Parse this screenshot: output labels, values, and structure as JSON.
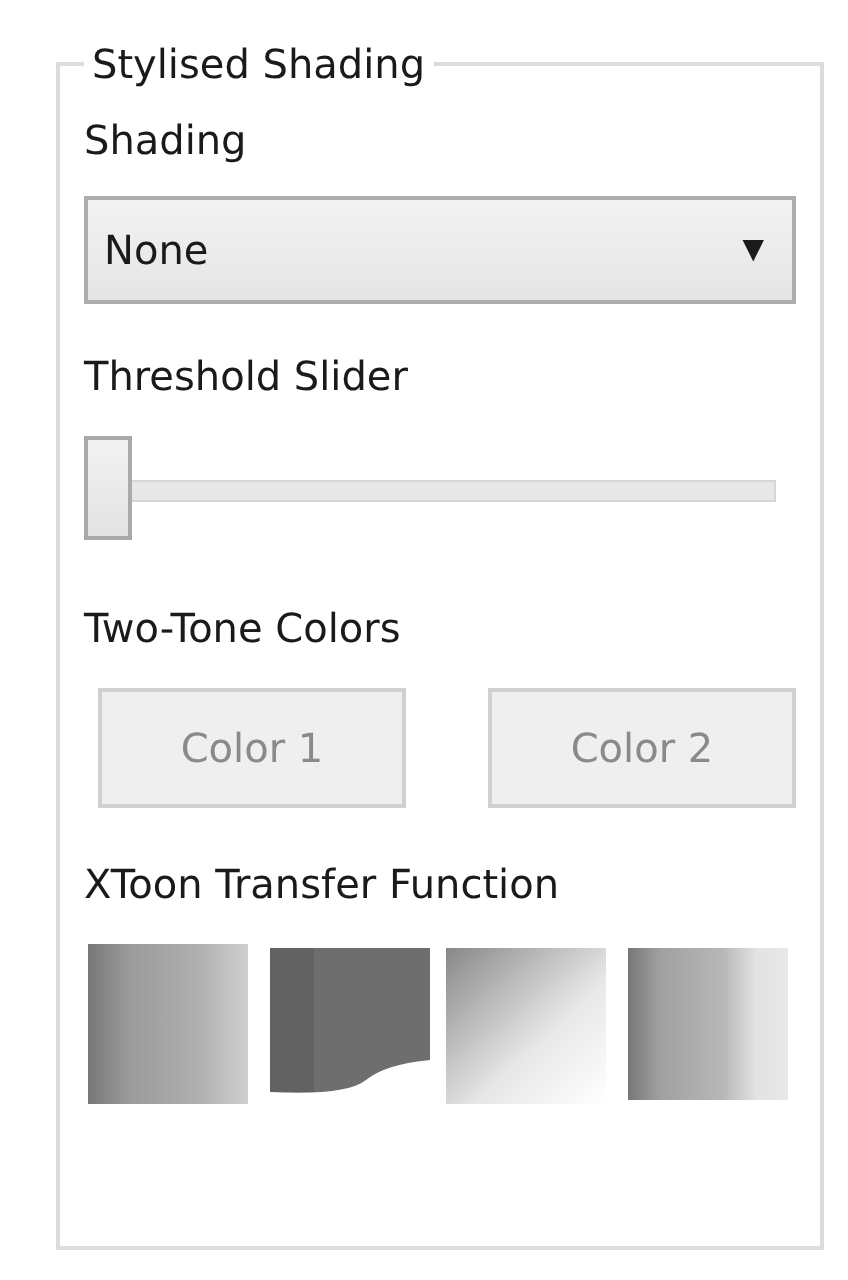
{
  "group": {
    "title": "Stylised Shading"
  },
  "shading": {
    "label": "Shading",
    "value": "None",
    "arrow": "▼"
  },
  "threshold": {
    "label": "Threshold Slider",
    "level": 0
  },
  "two_tone": {
    "label": "Two-Tone Colors",
    "buttons": [
      {
        "label": "Color 1",
        "disabled": true
      },
      {
        "label": "Color 2",
        "disabled": true
      }
    ]
  },
  "xtoon": {
    "label": "XToon Transfer Function"
  }
}
